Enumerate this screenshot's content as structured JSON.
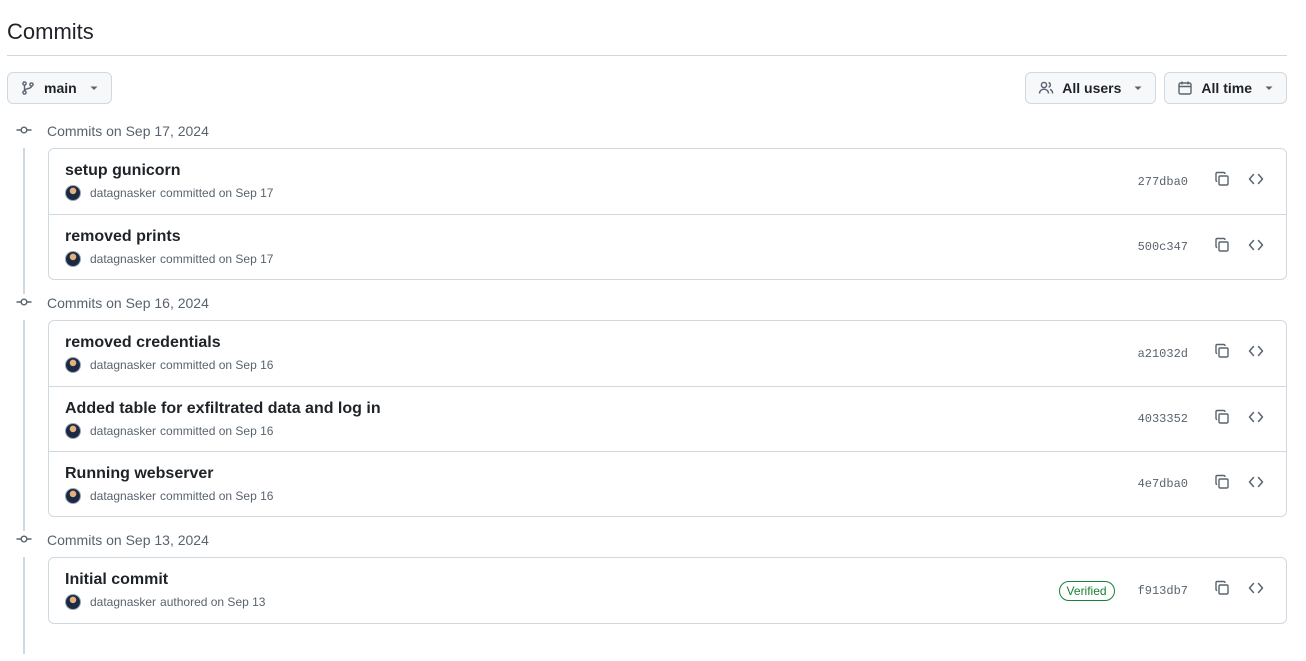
{
  "page": {
    "title": "Commits"
  },
  "toolbar": {
    "branch_label": "main",
    "users_label": "All users",
    "time_label": "All time"
  },
  "groups": [
    {
      "heading": "Commits on Sep 17, 2024",
      "commits": [
        {
          "message": "setup gunicorn",
          "author": "datagnasker",
          "action": "committed on Sep 17",
          "sha": "277dba0"
        },
        {
          "message": "removed prints",
          "author": "datagnasker",
          "action": "committed on Sep 17",
          "sha": "500c347"
        }
      ]
    },
    {
      "heading": "Commits on Sep 16, 2024",
      "commits": [
        {
          "message": "removed credentials",
          "author": "datagnasker",
          "action": "committed on Sep 16",
          "sha": "a21032d"
        },
        {
          "message": "Added table for exfiltrated data and log in",
          "author": "datagnasker",
          "action": "committed on Sep 16",
          "sha": "4033352"
        },
        {
          "message": "Running webserver",
          "author": "datagnasker",
          "action": "committed on Sep 16",
          "sha": "4e7dba0"
        }
      ]
    },
    {
      "heading": "Commits on Sep 13, 2024",
      "commits": [
        {
          "message": "Initial commit",
          "author": "datagnasker",
          "action": "authored on Sep 13",
          "sha": "f913db7",
          "badge": "Verified"
        }
      ]
    }
  ],
  "colors": {
    "border": "#d1d9e0",
    "muted": "#59636e",
    "verified": "#1a7f37"
  },
  "icons": {
    "branch": "git-branch-icon",
    "users": "people-icon",
    "time": "calendar-icon",
    "caret": "caret-down-icon",
    "commit": "git-commit-icon",
    "copy": "copy-icon",
    "browse": "code-icon"
  }
}
